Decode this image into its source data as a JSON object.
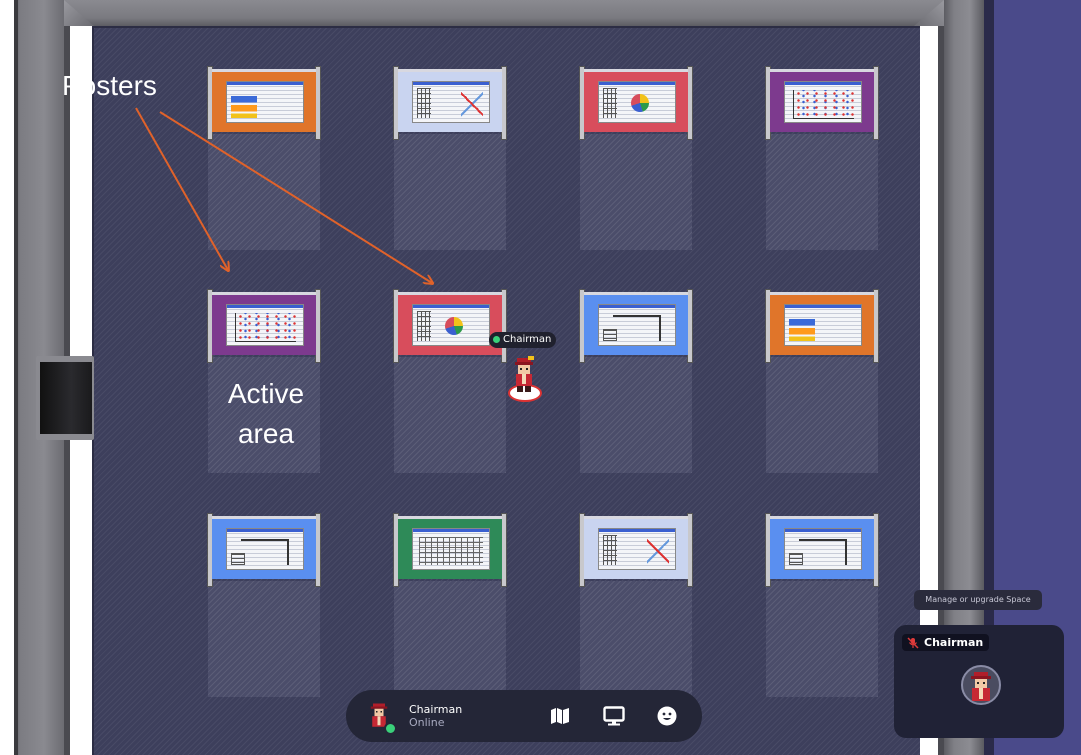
{
  "annotations": {
    "posters_label": "Posters",
    "active_area_line1": "Active",
    "active_area_line2": "area"
  },
  "player": {
    "name": "Chairman",
    "status": "Online"
  },
  "bottom_bar": {
    "name": "Chairman",
    "status": "Online",
    "buttons": [
      "map-icon",
      "screen-share-icon",
      "emoji-icon"
    ]
  },
  "tooltip": "Manage or upgrade Space",
  "video_tile": {
    "name": "Chairman",
    "mic": "muted"
  },
  "posters": [
    {
      "color": "orange"
    },
    {
      "color": "lightblue"
    },
    {
      "color": "red"
    },
    {
      "color": "purple"
    },
    {
      "color": "purple"
    },
    {
      "color": "red"
    },
    {
      "color": "blue"
    },
    {
      "color": "orange"
    },
    {
      "color": "blue"
    },
    {
      "color": "green"
    },
    {
      "color": "lightblue"
    },
    {
      "color": "blue"
    }
  ],
  "colors": {
    "floor": "#3d3f5c",
    "accent_arrow": "#e0622a",
    "online": "#3ad07a",
    "mute": "#e03a3a"
  }
}
